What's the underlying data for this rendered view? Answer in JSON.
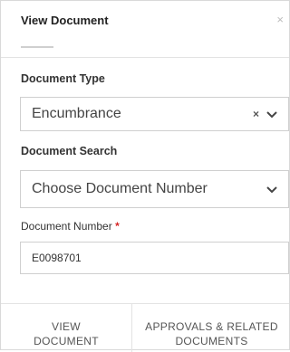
{
  "dialog": {
    "title": "View Document",
    "close_icon": "close-icon"
  },
  "document_type": {
    "label": "Document Type",
    "value": "Encumbrance",
    "clear_glyph": "×",
    "chevron_glyph": "⌄"
  },
  "document_search": {
    "label": "Document Search",
    "placeholder": "Choose Document Number",
    "chevron_glyph": "⌄"
  },
  "document_number": {
    "label": "Document Number",
    "required_mark": "*",
    "value": "E0098701"
  },
  "footer": {
    "view_button": "VIEW\nDOCUMENT",
    "approvals_button": "APPROVALS & RELATED\nDOCUMENTS"
  },
  "colors": {
    "required": "#d62828",
    "border": "#cfcfcf"
  }
}
